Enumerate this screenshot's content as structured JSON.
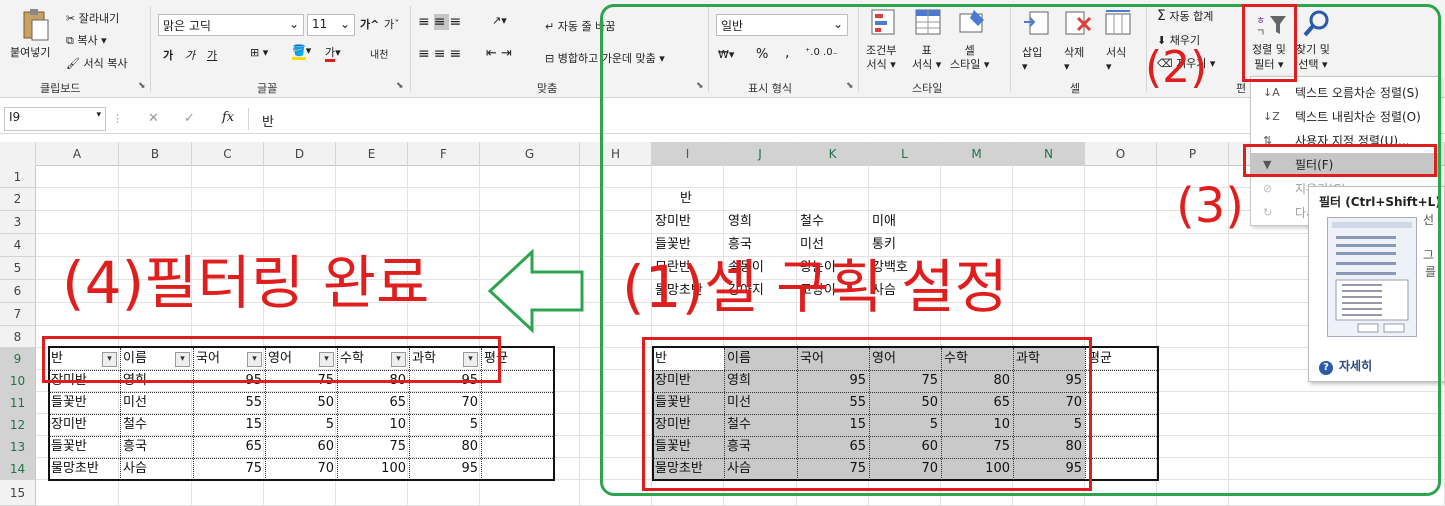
{
  "ribbon": {
    "clipboard": {
      "paste": "붙여넣기",
      "cut": "잘라내기",
      "copy": "복사",
      "format_painter": "서식 복사",
      "group": "클립보드"
    },
    "font": {
      "name": "맑은 고딕",
      "size": "11",
      "grow": "가",
      "shrink": "가",
      "bold": "가",
      "italic": "가",
      "underline": "가",
      "color_letter": "가",
      "phonetic": "내천",
      "group": "글꼴"
    },
    "alignment": {
      "wrap": "자동 줄 바꿈",
      "merge": "병합하고 가운데 맞춤",
      "group": "맞춤"
    },
    "number": {
      "format": "일반",
      "percent": "%",
      "comma": ",",
      "group": "표시 형식"
    },
    "styles": {
      "conditional": "조건부",
      "conditional2": "서식",
      "table": "표",
      "table2": "서식",
      "cell": "셀",
      "cell2": "스타일",
      "group": "스타일"
    },
    "cells": {
      "insert": "삽입",
      "delete": "삭제",
      "format": "서식",
      "group": "셀"
    },
    "editing": {
      "autosum": "자동 합계",
      "fill": "채우기",
      "clear": "지우기",
      "sort": "정렬 및",
      "sort2": "필터",
      "find": "찾기 및",
      "find2": "선택",
      "group": "편"
    }
  },
  "formula": {
    "namebox": "I9",
    "fx": "fx",
    "value": "반"
  },
  "columns": [
    "A",
    "B",
    "C",
    "D",
    "E",
    "F",
    "G",
    "H",
    "I",
    "J",
    "K",
    "L",
    "M",
    "N",
    "O",
    "P"
  ],
  "rows": [
    "1",
    "2",
    "3",
    "4",
    "5",
    "6",
    "7",
    "8",
    "9",
    "10",
    "11",
    "12",
    "13",
    "14",
    "15"
  ],
  "sheet": {
    "i2": "반",
    "upper": [
      [
        "장미반",
        "영희",
        "철수",
        "미애"
      ],
      [
        "들꽃반",
        "흥국",
        "미선",
        "통키"
      ],
      [
        "모란반",
        "송동이",
        "왕눈이",
        "강백호"
      ],
      [
        "물망초반",
        "강아지",
        "고양이",
        "사슴"
      ]
    ],
    "header": [
      "반",
      "이름",
      "국어",
      "영어",
      "수학",
      "과학",
      "평균"
    ],
    "rows": [
      [
        "장미반",
        "영희",
        "95",
        "75",
        "80",
        "95"
      ],
      [
        "들꽃반",
        "미선",
        "55",
        "50",
        "65",
        "70"
      ],
      [
        "장미반",
        "철수",
        "15",
        "5",
        "10",
        "5"
      ],
      [
        "들꽃반",
        "흥국",
        "65",
        "60",
        "75",
        "80"
      ],
      [
        "물망초반",
        "사슴",
        "75",
        "70",
        "100",
        "95"
      ]
    ]
  },
  "menu": {
    "sort_asc": "텍스트 오름차순 정렬(S)",
    "sort_desc": "텍스트 내림차순 정렬(O)",
    "custom": "사용자 지정 정렬(U)...",
    "filter": "필터(F)",
    "clear": "지우기(C)",
    "reapply": "다시 적용(Y)"
  },
  "tooltip": {
    "title": "필터 (Ctrl+Shift+L)",
    "text1": "선",
    "text2": "그",
    "text3": "를",
    "more": "자세히"
  },
  "annotations": {
    "step1": "(1)셀 구획 설정",
    "step2": "(2)",
    "step3": "(3)",
    "step4": "(4)필터링 완료"
  },
  "colors": {
    "accent": "#217346",
    "red": "#e01e1e",
    "green": "#2ea44f"
  }
}
